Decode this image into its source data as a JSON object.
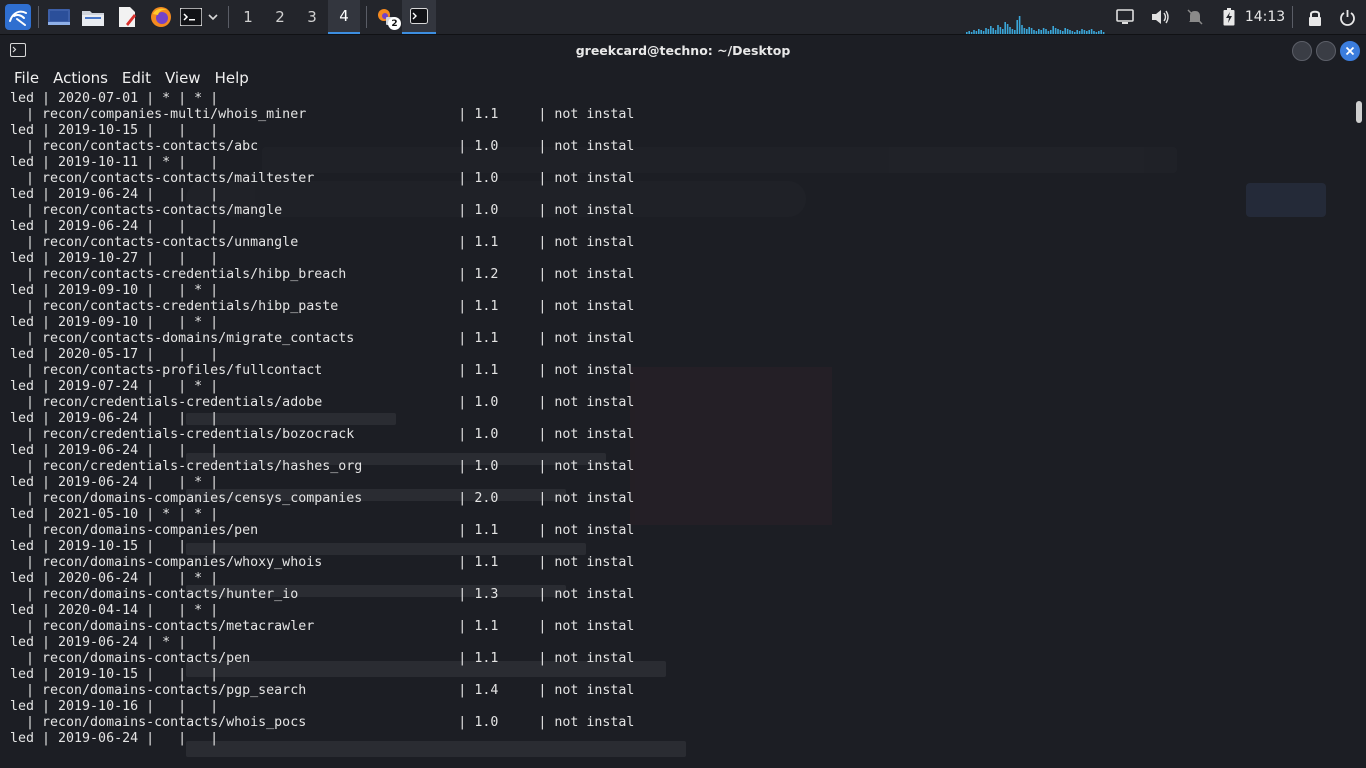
{
  "panel": {
    "workspaces": [
      "1",
      "2",
      "3",
      "4"
    ],
    "active_workspace": "4",
    "notification_count": "2",
    "clock": "14:13",
    "accent_color": "#3d8ee0",
    "icons": [
      "kali-menu-icon",
      "desktop-icon",
      "file-manager-icon",
      "text-editor-icon",
      "firefox-icon",
      "terminal-icon",
      "chevron-down-icon",
      "network-icon",
      "volume-icon",
      "notifications-muted-icon",
      "battery-icon",
      "lock-icon",
      "power-icon"
    ]
  },
  "window": {
    "title": "greekcard@techno: ~/Desktop",
    "menu": [
      "File",
      "Actions",
      "Edit",
      "View",
      "Help"
    ]
  },
  "terminal": {
    "lines": [
      "led | 2020-07-01 | * | * |",
      "  | recon/companies-multi/whois_miner                   | 1.1     | not instal",
      "led | 2019-10-15 |   |   |",
      "  | recon/contacts-contacts/abc                         | 1.0     | not instal",
      "led | 2019-10-11 | * |   |",
      "  | recon/contacts-contacts/mailtester                  | 1.0     | not instal",
      "led | 2019-06-24 |   |   |",
      "  | recon/contacts-contacts/mangle                      | 1.0     | not instal",
      "led | 2019-06-24 |   |   |",
      "  | recon/contacts-contacts/unmangle                    | 1.1     | not instal",
      "led | 2019-10-27 |   |   |",
      "  | recon/contacts-credentials/hibp_breach              | 1.2     | not instal",
      "led | 2019-09-10 |   | * |",
      "  | recon/contacts-credentials/hibp_paste               | 1.1     | not instal",
      "led | 2019-09-10 |   | * |",
      "  | recon/contacts-domains/migrate_contacts             | 1.1     | not instal",
      "led | 2020-05-17 |   |   |",
      "  | recon/contacts-profiles/fullcontact                 | 1.1     | not instal",
      "led | 2019-07-24 |   | * |",
      "  | recon/credentials-credentials/adobe                 | 1.0     | not instal",
      "led | 2019-06-24 |   |   |",
      "  | recon/credentials-credentials/bozocrack             | 1.0     | not instal",
      "led | 2019-06-24 |   |   |",
      "  | recon/credentials-credentials/hashes_org            | 1.0     | not instal",
      "led | 2019-06-24 |   | * |",
      "  | recon/domains-companies/censys_companies            | 2.0     | not instal",
      "led | 2021-05-10 | * | * |",
      "  | recon/domains-companies/pen                         | 1.1     | not instal",
      "led | 2019-10-15 |   |   |",
      "  | recon/domains-companies/whoxy_whois                 | 1.1     | not instal",
      "led | 2020-06-24 |   | * |",
      "  | recon/domains-contacts/hunter_io                    | 1.3     | not instal",
      "led | 2020-04-14 |   | * |",
      "  | recon/domains-contacts/metacrawler                  | 1.1     | not instal",
      "led | 2019-06-24 | * |   |",
      "  | recon/domains-contacts/pen                          | 1.1     | not instal",
      "led | 2019-10-15 |   |   |",
      "  | recon/domains-contacts/pgp_search                   | 1.4     | not instal",
      "led | 2019-10-16 |   |   |",
      "  | recon/domains-contacts/whois_pocs                   | 1.0     | not instal",
      "led | 2019-06-24 |   |   |"
    ]
  }
}
